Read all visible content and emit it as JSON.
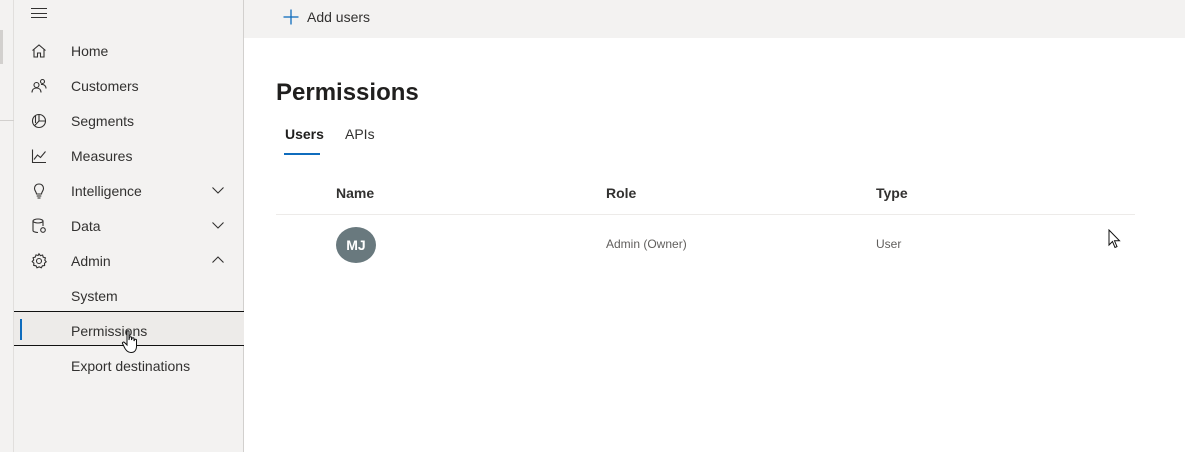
{
  "sidebar": {
    "items": [
      {
        "label": "Home",
        "icon": "home-icon"
      },
      {
        "label": "Customers",
        "icon": "customers-icon"
      },
      {
        "label": "Segments",
        "icon": "segments-icon"
      },
      {
        "label": "Measures",
        "icon": "measures-icon"
      },
      {
        "label": "Intelligence",
        "icon": "lightbulb-icon",
        "chevron": "down"
      },
      {
        "label": "Data",
        "icon": "database-icon",
        "chevron": "down"
      },
      {
        "label": "Admin",
        "icon": "gear-icon",
        "chevron": "up"
      }
    ],
    "admin_subitems": [
      {
        "label": "System"
      },
      {
        "label": "Permissions",
        "active": true
      },
      {
        "label": "Export destinations"
      }
    ]
  },
  "toolbar": {
    "add_users_label": "Add users",
    "add_users_icon": "plus-icon"
  },
  "page": {
    "title": "Permissions",
    "tabs": [
      {
        "label": "Users",
        "selected": true
      },
      {
        "label": "APIs",
        "selected": false
      }
    ]
  },
  "table": {
    "columns": [
      "Name",
      "Role",
      "Type"
    ],
    "rows": [
      {
        "initials": "MJ",
        "role": "Admin (Owner)",
        "type": "User"
      }
    ]
  },
  "colors": {
    "accent": "#0f6cbd",
    "sidebar_bg": "#f3f2f1",
    "avatar_bg": "#69797e"
  }
}
